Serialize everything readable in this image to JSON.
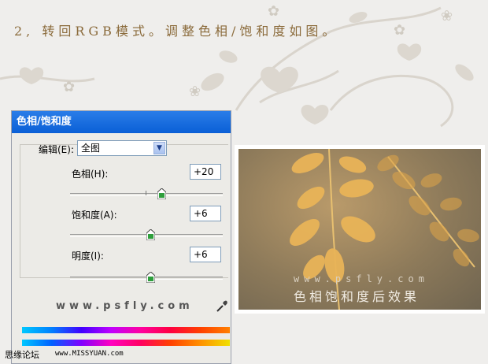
{
  "instruction": "2, 转回RGB模式。调整色相/饱和度如图。",
  "dialog": {
    "title": "色相/饱和度",
    "edit_label": "编辑(E):",
    "edit_value": "全图",
    "hue_label": "色相(H):",
    "hue_value": "+20",
    "saturation_label": "饱和度(A):",
    "saturation_value": "+6",
    "lightness_label": "明度(I):",
    "lightness_value": "+6",
    "watermark": "www.psfly.com"
  },
  "photo": {
    "url_text": "www.psfly.com",
    "caption": "色相饱和度后效果"
  },
  "footer": {
    "logo": "思缘论坛",
    "url": "www.MISSYUAN.com"
  },
  "colors": {
    "titlebar": "#0a5fd6",
    "thumb": "#2e9e3c",
    "instruction_text": "#8a6a3a"
  },
  "icons": {
    "select_arrow": "chevron-down-icon",
    "eyedropper": "eyedropper-icon"
  }
}
